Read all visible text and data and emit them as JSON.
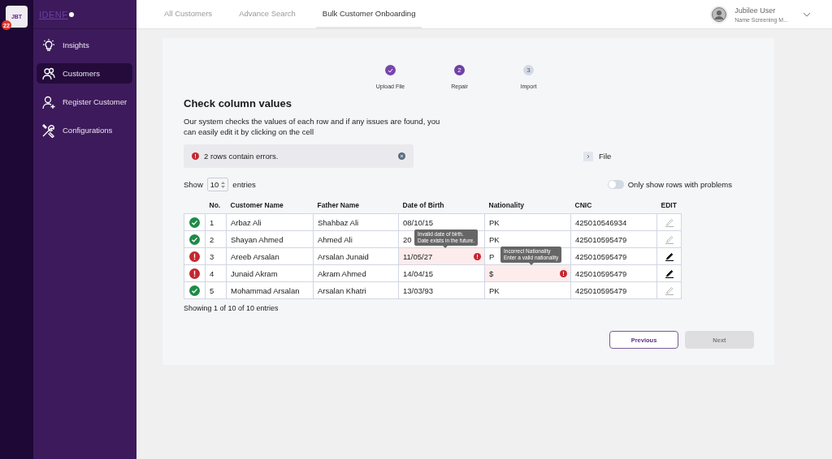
{
  "rail": {
    "tile": "JBT",
    "badge": "22"
  },
  "sidebar": {
    "logo": "IDENF",
    "items": [
      {
        "label": "Insights",
        "selected": false
      },
      {
        "label": "Customers",
        "selected": true
      },
      {
        "label": "Register Customer",
        "selected": false
      },
      {
        "label": "Configurations",
        "selected": false
      }
    ]
  },
  "top_tabs": [
    {
      "label": "All Customers",
      "selected": false
    },
    {
      "label": "Advance Search",
      "selected": false
    },
    {
      "label": "Bulk Customer Onboarding",
      "selected": true
    }
  ],
  "user": {
    "name": "Jubilee User",
    "role": "Name Screening M..."
  },
  "steps": [
    {
      "label": "Upload File",
      "completed": true,
      "active": false
    },
    {
      "label": "Repair",
      "number": "2",
      "completed": false,
      "active": true
    },
    {
      "label": "Import",
      "number": "3",
      "completed": false,
      "active": false
    }
  ],
  "heading": "Check column values",
  "description": "Our system checks the values of each row and if any issues are found, you can easily edit it by clicking on the cell",
  "alert": {
    "text": "2 rows contain errors."
  },
  "file_link": "File",
  "show": {
    "prefix": "Show",
    "value": "10",
    "suffix": "entries"
  },
  "filter_toggle": {
    "label": "Only show rows with problems",
    "on": false
  },
  "columns": [
    "No.",
    "Customer Name",
    "Father Name",
    "Date of Birth",
    "Nationality",
    "CNIC",
    "EDIT"
  ],
  "rows": [
    {
      "has_error": false,
      "cells": [
        {
          "text": "1"
        },
        {
          "text": "Arbaz Ali"
        },
        {
          "text": "Shahbaz Ali"
        },
        {
          "text": "08/10/15",
          "invalid": false
        },
        {
          "text": "PK",
          "invalid": false
        },
        {
          "text": "425010546934"
        }
      ]
    },
    {
      "has_error": false,
      "cells": [
        {
          "text": "2"
        },
        {
          "text": "Shayan Ahmed"
        },
        {
          "text": "Ahmed Ali"
        },
        {
          "text": "20",
          "invalid": false
        },
        {
          "text": "PK",
          "invalid": false
        },
        {
          "text": "425010595479"
        }
      ]
    },
    {
      "has_error": true,
      "cells": [
        {
          "text": "3"
        },
        {
          "text": "Areeb Arsalan"
        },
        {
          "text": "Arsalan Junaid"
        },
        {
          "text": "11/05/27",
          "invalid": true,
          "tooltip": [
            "Invalid date of birth.",
            "Date exists in the future."
          ]
        },
        {
          "text": "P",
          "invalid": false
        },
        {
          "text": "425010595479"
        }
      ]
    },
    {
      "has_error": true,
      "cells": [
        {
          "text": "4"
        },
        {
          "text": "Junaid Akram"
        },
        {
          "text": "Akram Ahmed"
        },
        {
          "text": "14/04/15",
          "invalid": false
        },
        {
          "text": "$",
          "invalid": true,
          "tooltip": [
            "Incorrect Nationality",
            "Enter a valid nationality"
          ]
        },
        {
          "text": "425010595479"
        }
      ]
    },
    {
      "has_error": false,
      "cells": [
        {
          "text": "5"
        },
        {
          "text": "Mohammad Arsalan"
        },
        {
          "text": "Arsalan Khatri"
        },
        {
          "text": "13/03/93",
          "invalid": false
        },
        {
          "text": "PK",
          "invalid": false
        },
        {
          "text": "425010595479"
        }
      ]
    }
  ],
  "footer": "Showing 1 of 10 of 10 entries",
  "buttons": [
    {
      "label": "Previous",
      "disabled": false
    },
    {
      "label": "Next",
      "disabled": true
    }
  ]
}
